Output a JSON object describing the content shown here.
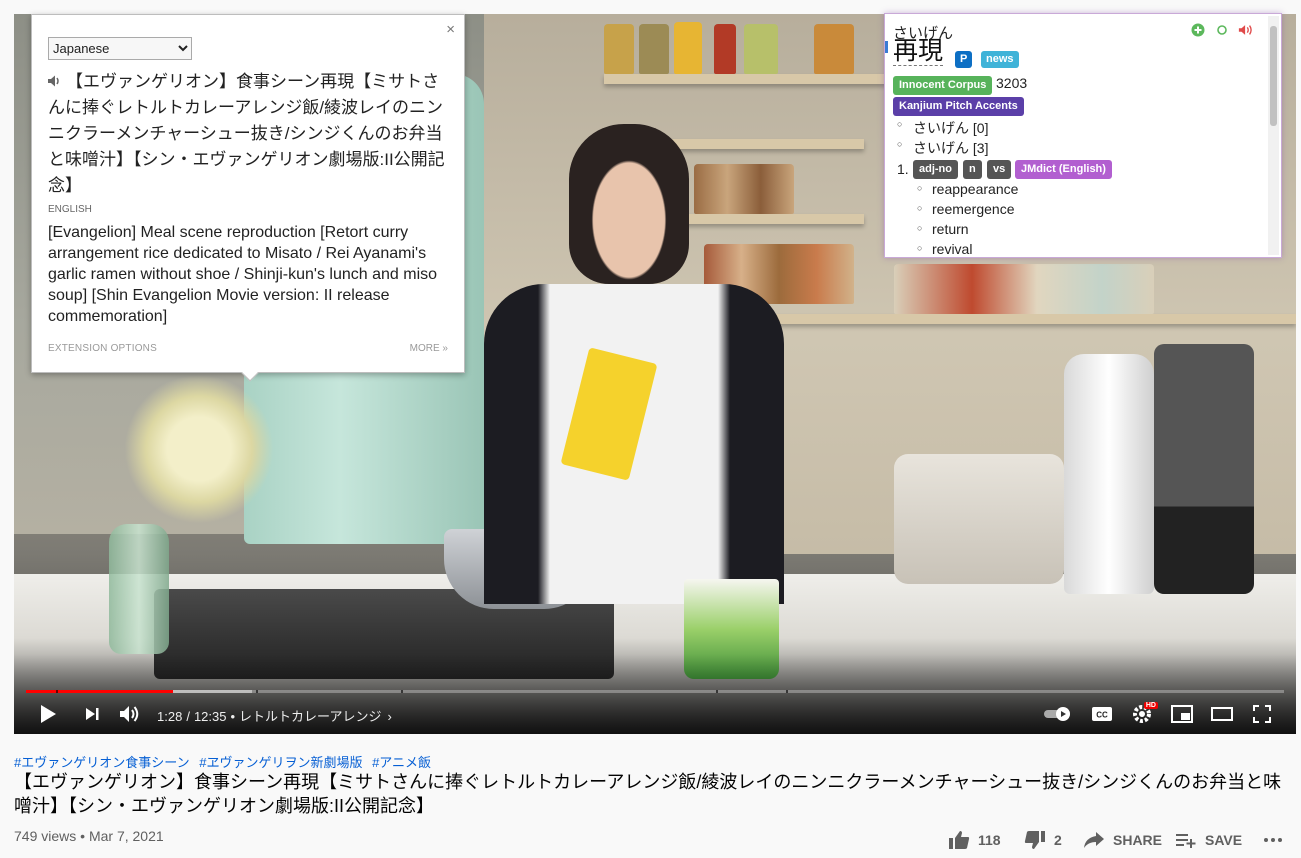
{
  "translate_popup": {
    "language_select": "Japanese",
    "language_options": [
      "Japanese"
    ],
    "close_label": "×",
    "source_text": "【エヴァンゲリオン】食事シーン再現【ミサトさんに捧ぐレトルトカレーアレンジ飯/綾波レイのニンニクラーメンチャーシュー抜き/シンジくんのお弁当と味噌汁】【シン・エヴァンゲリオン劇場版:II公開記念】",
    "target_language": "ENGLISH",
    "translation": "[Evangelion] Meal scene reproduction [Retort curry arrangement rice dedicated to Misato / Rei Ayanami's garlic ramen without shoe / Shinji-kun's lunch and miso soup] [Shin Evangelion Movie version: II release commemoration]",
    "extension_options": "EXTENSION OPTIONS",
    "more": "MORE »"
  },
  "dictionary_popup": {
    "reading": "さいげん",
    "term": "再現",
    "tags": [
      "P",
      "news"
    ],
    "frequency_source": "Innocent Corpus",
    "frequency_value": "3203",
    "pitch_source": "Kanjium Pitch Accents",
    "pitch_accents": [
      "さいげん [0]",
      "さいげん [3]"
    ],
    "definition_number": "1.",
    "pos_tags": [
      "adj-no",
      "n",
      "vs"
    ],
    "dictionary": "JMdict (English)",
    "glosses": [
      "reappearance",
      "reemergence",
      "return",
      "revival"
    ],
    "colors": {
      "p": "#0d6fc4",
      "news": "#3fb3d8",
      "corpus": "#57b35b",
      "kanjium": "#5b3fa8",
      "pos": "#555555",
      "dict": "#b25fd0"
    }
  },
  "player": {
    "current_time": "1:28",
    "duration": "12:35",
    "chapter": "レトルトカレーアレンジ",
    "progress_fraction": 0.117,
    "loaded_fraction": 0.18,
    "hd_badge": "HD",
    "icons": [
      "play-icon",
      "next-icon",
      "volume-icon",
      "autoplay-toggle",
      "cc-icon",
      "settings-icon",
      "miniplayer-icon",
      "theater-icon",
      "fullscreen-icon"
    ]
  },
  "video": {
    "hashtags": [
      "#エヴァンゲリオン食事シーン",
      "#ヱヴァンゲリヲン新劇場版",
      "#アニメ飯"
    ],
    "title": "【エヴァンゲリオン】食事シーン再現【ミサトさんに捧ぐレトルトカレーアレンジ飯/綾波レイのニンニクラーメンチャーシュー抜き/シンジくんのお弁当と味噌汁】【シン・エヴァンゲリオン劇場版:II公開記念】",
    "views": "749 views",
    "date": "Mar 7, 2021",
    "likes": "118",
    "dislikes": "2",
    "share_label": "SHARE",
    "save_label": "SAVE"
  }
}
